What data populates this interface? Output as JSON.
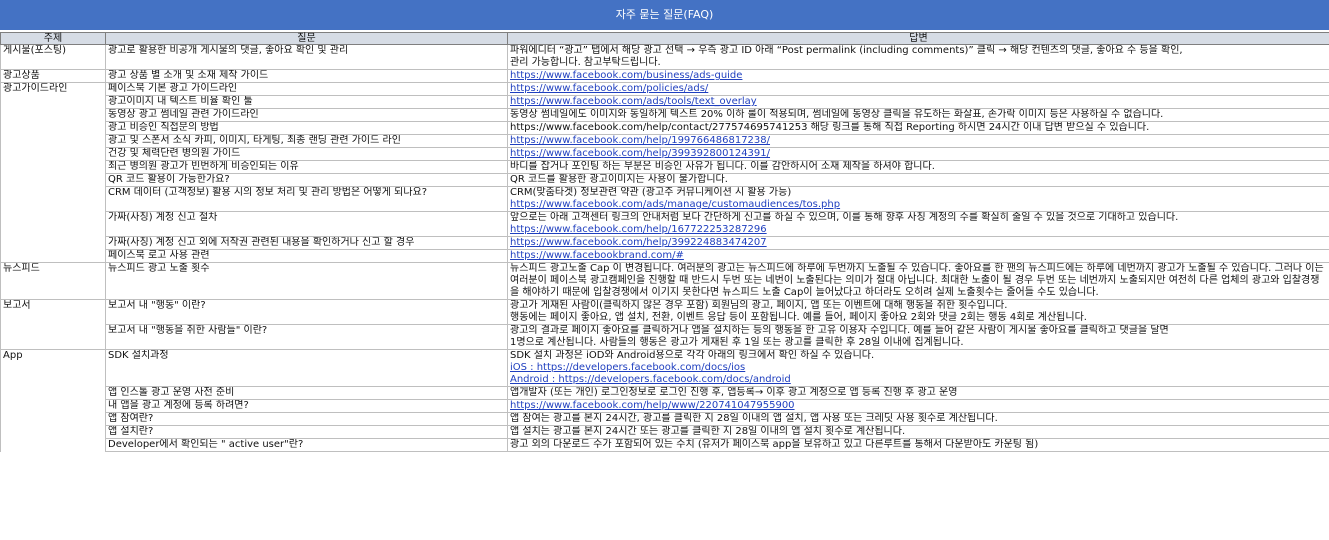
{
  "title": "자주 묻는 질문(FAQ)",
  "headers": {
    "topic": "주제",
    "question": "질문",
    "answer": "답변"
  },
  "rows": [
    {
      "topic": "게시물(포스팅)",
      "q": "광고로 활용한 비공개 게시물의 댓글, 좋아요 확인 및 관리",
      "a": [
        {
          "t": "파워에디터 “광고” 탭에서 해당 광고 선택 → 우측 광고 ID 아래 “Post permalink (including comments)” 클릭 → 해당 컨텐츠의 댓글, 좋아요 수 등을 확인,"
        },
        {
          "t": "관리 가능합니다. 참고부탁드립니다."
        }
      ]
    },
    {
      "topic": "광고상품",
      "q": "광고 상품 별 소개 및 소재 제작 가이드",
      "a": [
        {
          "t": "https://www.facebook.com/business/ads-guide",
          "link": true
        }
      ]
    },
    {
      "topic": "광고가이드라인",
      "q": "페이스북 기본 광고 가이드라인",
      "a": [
        {
          "t": "https://www.facebook.com/policies/ads/",
          "link": true
        }
      ]
    },
    {
      "topic": "",
      "q": "광고이미지 내 텍스트 비율 확인 툴",
      "a": [
        {
          "t": "https://www.facebook.com/ads/tools/text_overlay",
          "link": true
        }
      ]
    },
    {
      "topic": "",
      "q": "동영상 광고 썸네일 관련 가이드라인",
      "a": [
        {
          "t": "동영상 썸네일에도 이미지와 동일하게 텍스트 20% 이하 룰이 적용되며, 썸네일에 동영상 클릭을 유도하는 화살표, 손가락 이미지 등은 사용하실 수 없습니다."
        }
      ]
    },
    {
      "topic": "",
      "q": "광고 비승인 직접문의 방법",
      "a": [
        {
          "t": "https://www.facebook.com/help/contact/277574695741253 해당 링크를 통해 직접 Reporting 하시면 24시간 이내 답변 받으실 수 있습니다."
        }
      ]
    },
    {
      "topic": "",
      "q": "광고 및 스폰서 소식 카피, 이미지, 타게팅, 최종 랜딩 관련 가이드 라인",
      "a": [
        {
          "t": "https://www.facebook.com/help/199766486817238/",
          "link": true
        }
      ]
    },
    {
      "topic": "",
      "q": "건강 및 체력단련 병의원 가이드",
      "a": [
        {
          "t": "https://www.facebook.com/help/399392800124391/",
          "link": true
        }
      ]
    },
    {
      "topic": "",
      "q": "최근 병의원 광고가 빈번하게 비승인되는 이유",
      "a": [
        {
          "t": "바디를 잡거나 포인팅 하는 부분은 비승인 사유가 됩니다. 이를 감안하시어 소재 제작을 하셔야 합니다."
        }
      ]
    },
    {
      "topic": "",
      "q": "QR 코드 활용이 가능한가요?",
      "a": [
        {
          "t": "QR 코드를 활용한 광고이미지는 사용이 불가합니다."
        }
      ]
    },
    {
      "topic": "",
      "q": "CRM 데이터 (고객정보) 활용 시의 정보 처리 및 관리 방법은 어떻게 되나요?",
      "a": [
        {
          "t": "CRM(맞춤타겟) 정보관련 약관 (광고주 커뮤니케이션 시 활용 가능)"
        },
        {
          "t": "https://www.facebook.com/ads/manage/customaudiences/tos.php",
          "link": true
        }
      ]
    },
    {
      "topic": "",
      "q": "가짜(사칭) 계정 신고 절차",
      "a": [
        {
          "t": "앞으로는 아래 고객센터 링크의 안내처럼 보다 간단하게 신고를 하실 수 있으며, 이를 통해 향후 사칭 계정의 수를 확실히 줄일 수 있을 것으로 기대하고 있습니다."
        },
        {
          "t": "https://www.facebook.com/help/167722253287296",
          "link": true
        }
      ]
    },
    {
      "topic": "",
      "q": "가짜(사칭) 계정 신고 외에 저작권 관련된 내용을 확인하거나 신고 할 경우",
      "a": [
        {
          "t": "https://www.facebook.com/help/399224883474207",
          "link": true
        }
      ]
    },
    {
      "topic": "",
      "q": "페이스북 로고 사용 관련",
      "a": [
        {
          "t": "https://www.facebookbrand.com/#",
          "link": true
        }
      ]
    },
    {
      "topic": "뉴스피드",
      "q": "뉴스피드 광고 노출 횟수",
      "wrap": true,
      "a": [
        {
          "t": "뉴스피드 광고노출 Cap 이 변경됩니다. 여러분의 광고는 뉴스피드에 하루에 두번까지 노출될 수 있습니다. 좋아요를 한 팬의 뉴스피드에는 하루에 네번까지 광고가 노출될 수 있습니다. 그러나 이는 여러분이 페이스북 광고캠페인을 진행할 때 반드시 두번 또는 네번이 노출된다는 의미가 절대 아닙니다. 최대한 노출이 될 경우 두번 또는 네번까지 노출되지만 여전히 다른 업체의 광고와 입찰경쟁을 해야하기 때문에 입찰경쟁에서 이기지 못한다면 뉴스피드 노출 Cap이 늘어났다고 하더라도 오히려 실제 노출횟수는 줄어들 수도 있습니다."
        }
      ]
    },
    {
      "topic": "보고서",
      "q": "보고서 내 \"행동\" 이란?",
      "a": [
        {
          "t": "광고가 게재된 사람이(클릭하지 않은 경우 포함) 회원님의 광고, 페이지, 앱 또는 이벤트에 대해 행동을 취한 횟수입니다."
        },
        {
          "t": "행동에는 페이지 좋아요, 앱 설치, 전환, 이벤트 응답 등이 포함됩니다. 예를 들어, 페이지 좋아요 2회와 댓글 2회는 행동 4회로 계산됩니다."
        }
      ]
    },
    {
      "topic": "",
      "q": "보고서 내 \"행동을 취한 사람들\" 이란?",
      "a": [
        {
          "t": "광고의 결과로 페이지 좋아요를 클릭하거나 앱을 설치하는 등의 행동을 한 고유 이용자 수입니다. 예를 들어 같은 사람이 게시물 좋아요를 클릭하고 댓글을 달면"
        },
        {
          "t": "1명으로 계산됩니다. 사람들의 행동은 광고가 게재된 후 1일 또는 광고를 클릭한 후 28일 이내에 집계됩니다."
        }
      ]
    },
    {
      "topic": "App",
      "q": "SDK 설치과정",
      "a": [
        {
          "t": "SDK 설치 과정은 iOD와 Android용으로 각각 아래의 링크에서 확인 하실 수 있습니다."
        },
        {
          "t": "iOS : https://developers.facebook.com/docs/ios",
          "link": true
        },
        {
          "t": "Android : https://developers.facebook.com/docs/android",
          "link": true
        }
      ]
    },
    {
      "topic": "",
      "q": "앱 인스톨 광고 운영 사전 준비",
      "a": [
        {
          "t": "앱개발자 (또는 개인) 로그인정보로 로그인 진행 후, 앱등록→ 이후 광고 계정으로 앱 등록 진행 후 광고 운영"
        }
      ]
    },
    {
      "topic": "",
      "q": "내 앱을 광고 계정에 등록 하려면?",
      "a": [
        {
          "t": "https://www.facebook.com/help/www/220741047955900",
          "link": true
        }
      ]
    },
    {
      "topic": "",
      "q": "앱 참여란?",
      "a": [
        {
          "t": "앱 참여는 광고를 본지 24시간, 광고를 클릭한 지 28일 이내의 앱 설치, 앱 사용 또는 크레딧 사용 횟수로 계산됩니다."
        }
      ]
    },
    {
      "topic": "",
      "q": "앱 설치란?",
      "a": [
        {
          "t": "앱 설치는 광고를 본지 24시간 또는 광고를 클릭한 지 28일 이내의 앱 설치 횟수로 계산됩니다."
        }
      ]
    },
    {
      "topic": "",
      "q": "Developer에서 확인되는 \" active user\"란?",
      "a": [
        {
          "t": "광고 외의 다운로드 수가 포함되어 있는 수치 (유저가 페이스북 app을 보유하고 있고 다른루트를 통해서 다운받아도 카운팅 됨)"
        }
      ]
    }
  ]
}
